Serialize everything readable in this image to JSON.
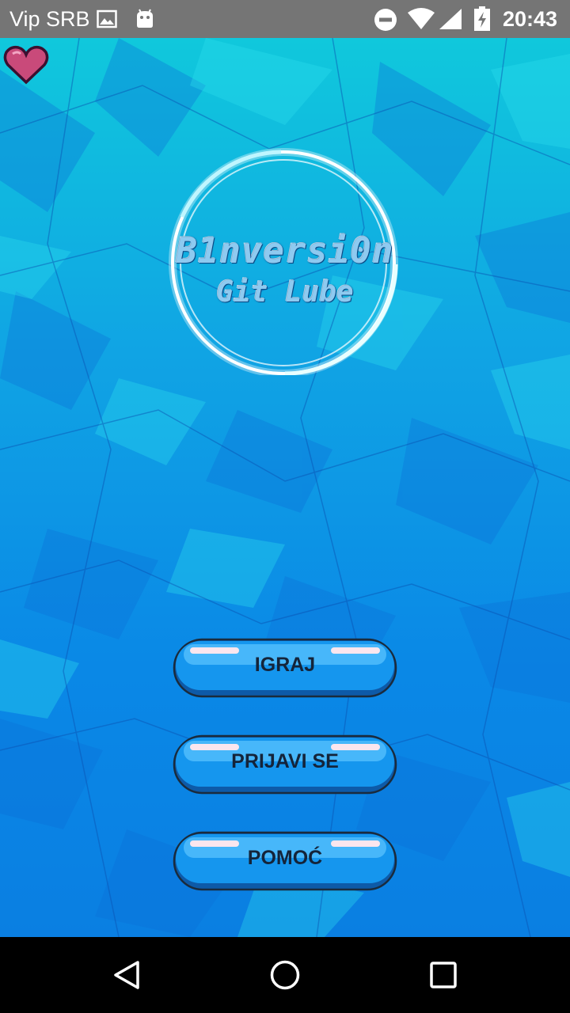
{
  "status_bar": {
    "carrier": "Vip SRB",
    "time": "20:43",
    "icons": [
      "image-icon",
      "android-icon",
      "do-not-disturb-icon",
      "wifi-icon",
      "cell-signal-icon",
      "battery-charging-icon"
    ]
  },
  "app": {
    "logo": {
      "line1": "B1nversi0n",
      "line2": "Git Lube"
    },
    "lives_icon": "heart-icon",
    "buttons": [
      {
        "label": "IGRAJ"
      },
      {
        "label": "PRIJAVI SE"
      },
      {
        "label": "POMOĆ"
      }
    ]
  },
  "nav_bar": {
    "icons": [
      "back-icon",
      "home-icon",
      "recents-icon"
    ]
  },
  "colors": {
    "status_bar": "#757575",
    "background_top": "#10c8dc",
    "background_bottom": "#0a7fe2",
    "button_fill": "#1596ee",
    "button_text": "#14243a",
    "heart": "#c94a7a"
  }
}
